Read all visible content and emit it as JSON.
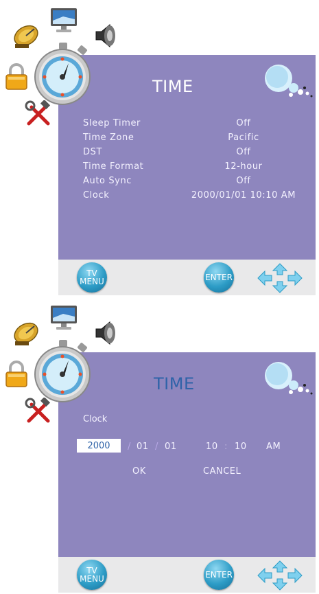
{
  "colors": {
    "panel": "#8e86be",
    "bar": "#e9e9ea",
    "title_focus": "#2f63a8",
    "text": "#f4f2ff"
  },
  "icons": [
    "satellite-dish-icon",
    "monitor-icon",
    "speaker-icon",
    "lock-icon",
    "stopwatch-icon",
    "tools-icon",
    "bubbles-logo-icon",
    "dpad-arrows-icon"
  ],
  "screen1": {
    "title": "TIME",
    "rows": [
      {
        "label": "Sleep Timer",
        "value": "Off"
      },
      {
        "label": "Time Zone",
        "value": "Pacific"
      },
      {
        "label": "DST",
        "value": "Off"
      },
      {
        "label": "Time Format",
        "value": "12-hour"
      },
      {
        "label": "Auto Sync",
        "value": "Off"
      },
      {
        "label": "Clock",
        "value": "2000/01/01 10:10 AM"
      }
    ],
    "tv_menu_label_1": "TV",
    "tv_menu_label_2": "MENU",
    "enter_label": "ENTER"
  },
  "screen2": {
    "title": "TIME",
    "clock_label": "Clock",
    "year": "2000",
    "sep1": "/",
    "month": "01",
    "sep2": "/",
    "day": "01",
    "hour": "10",
    "colon": ":",
    "minute": "10",
    "ampm": "AM",
    "ok_label": "OK",
    "cancel_label": "CANCEL",
    "tv_menu_label_1": "TV",
    "tv_menu_label_2": "MENU",
    "enter_label": "ENTER"
  }
}
